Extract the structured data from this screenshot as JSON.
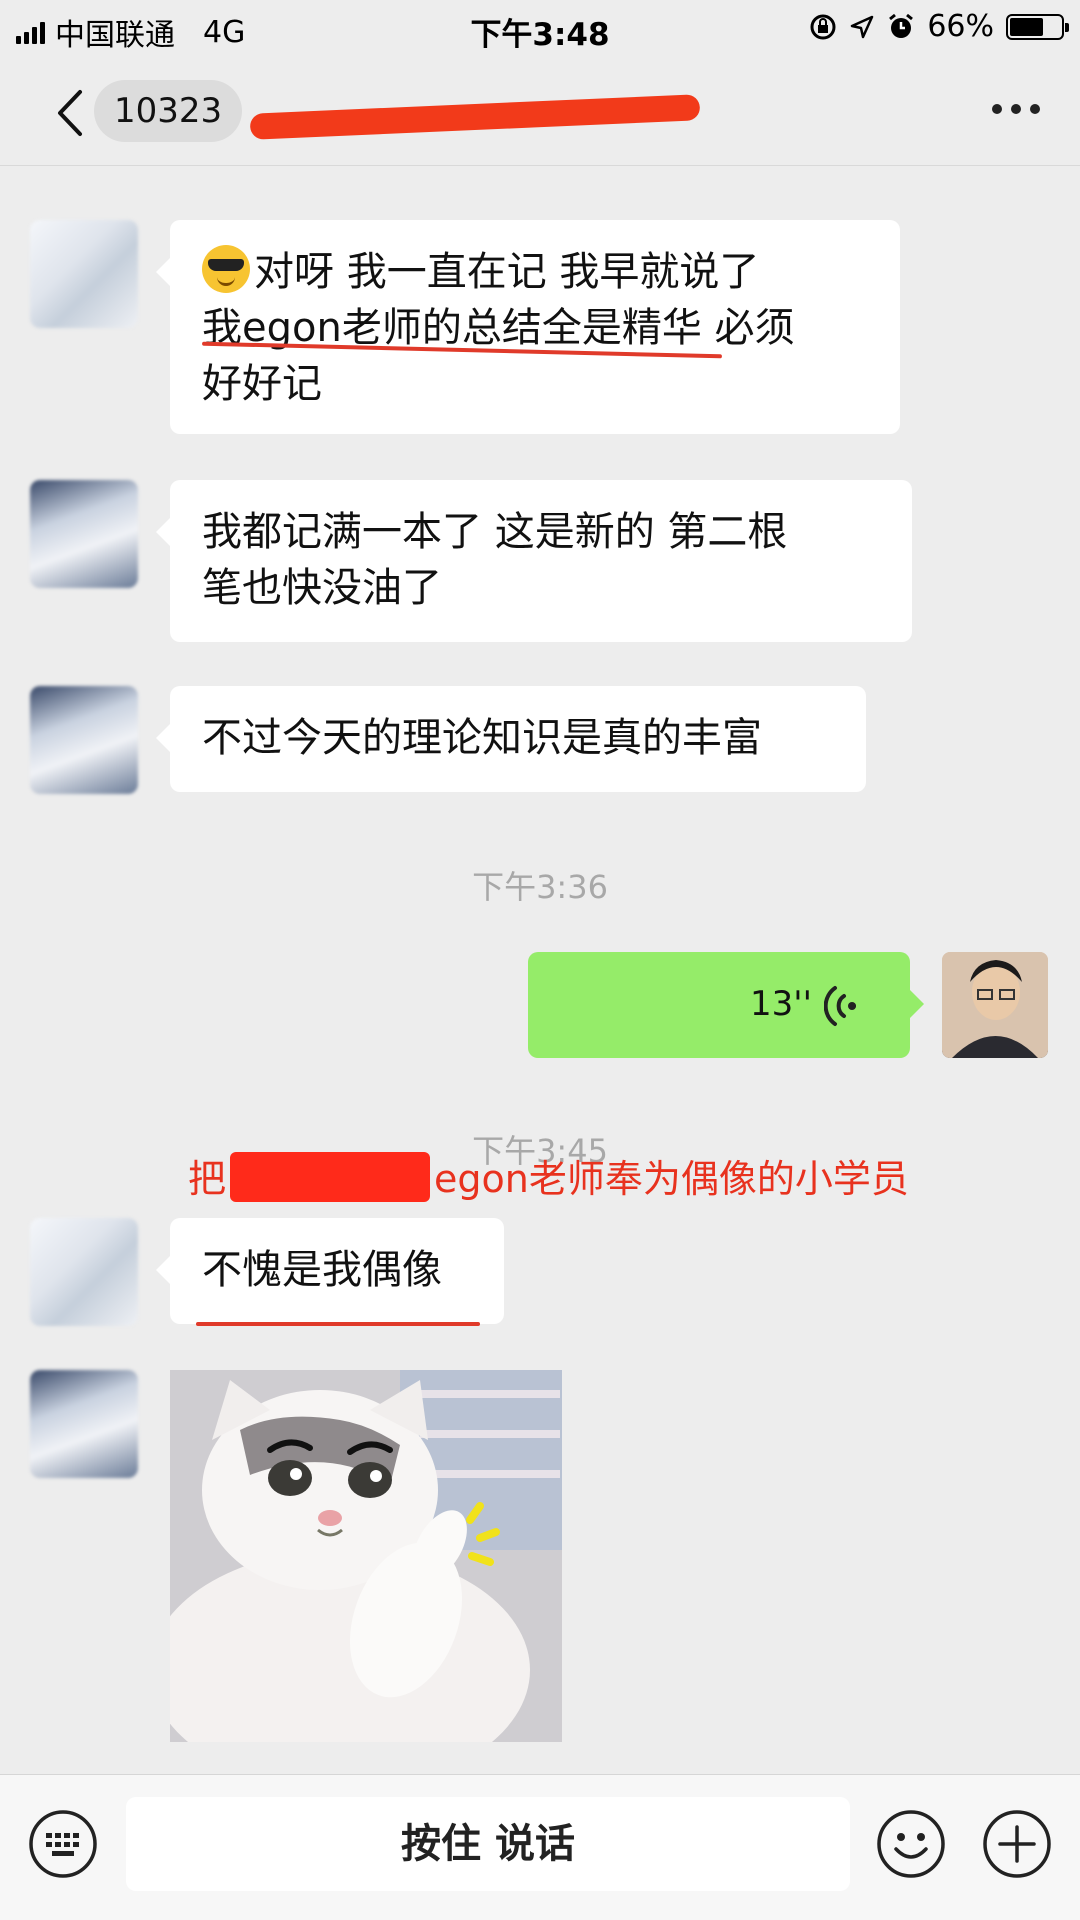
{
  "status_bar": {
    "carrier": "中国联通",
    "network": "4G",
    "time": "下午3:48",
    "battery_percent": "66%",
    "battery_level": 0.66
  },
  "nav": {
    "unread_count": "10323",
    "back_icon": "chevron-left-icon",
    "more_icon": "more-horizontal-icon"
  },
  "messages": [
    {
      "side": "left",
      "emoji": "sunglasses-face",
      "lines": [
        "对呀  我一直在记  我早就说了",
        "我egon老师的总结全是精华  必须",
        "好好记"
      ]
    },
    {
      "side": "left",
      "lines": [
        "我都记满一本了  这是新的  第二根",
        "笔也快没油了"
      ]
    },
    {
      "side": "left",
      "lines": [
        "不过今天的理论知识是真的丰富"
      ]
    },
    {
      "type": "timestamp",
      "text": "下午3:36"
    },
    {
      "side": "right",
      "type": "voice",
      "duration": "13''"
    },
    {
      "type": "timestamp",
      "text": "下午3:45"
    },
    {
      "side": "left",
      "lines": [
        "不愧是我偶像"
      ]
    },
    {
      "side": "left",
      "type": "sticker",
      "description": "cat-thumbs-up-sticker"
    }
  ],
  "annotation": {
    "prefix": "把",
    "suffix": "egon老师奉为偶像的小学员",
    "color": "#e8321e"
  },
  "input_bar": {
    "hold_to_talk": "按住 说话",
    "keyboard_icon": "keyboard-icon",
    "emoji_icon": "smiley-icon",
    "plus_icon": "plus-circle-icon"
  },
  "colors": {
    "background": "#ededed",
    "my_bubble": "#95ec69",
    "their_bubble": "#ffffff",
    "redaction": "#f23a1a"
  }
}
